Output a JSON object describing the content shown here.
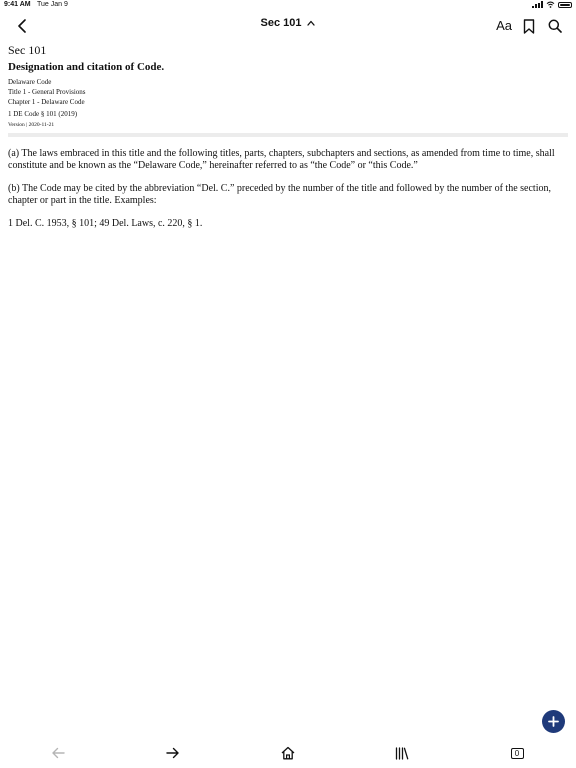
{
  "status_bar": {
    "time": "9:41 AM",
    "date": "Tue Jan 9"
  },
  "nav": {
    "title": "Sec 101",
    "font_size_button": "Aa",
    "icons": [
      "chevron-left-icon",
      "chevron-up-icon",
      "bookmark-icon",
      "search-icon"
    ]
  },
  "document": {
    "section_label": "Sec 101",
    "heading": "Designation and citation of Code.",
    "breadcrumb": [
      "Delaware Code",
      "Title 1 - General Provisions",
      "Chapter 1 - Delaware Code"
    ],
    "citation": "1 DE Code § 101 (2019)",
    "version": "Version | 2020-11-21",
    "paragraphs": [
      "(a) The laws embraced in this title and the following titles, parts, chapters, subchapters and sections, as amended from time to time, shall constitute and be known as the “Delaware Code,” hereinafter referred to as “the Code” or “this Code.”",
      "(b) The Code may be cited by the abbreviation “Del. C.” preceded by the number of the title and followed by the number of the section, chapter or part in the title. Examples:",
      "1 Del. C. 1953, § 101; 49 Del. Laws, c. 220, § 1."
    ]
  },
  "fab": {
    "icon": "plus-icon"
  },
  "tab_bar": {
    "icons": [
      "arrow-left-icon",
      "arrow-right-icon",
      "home-icon",
      "library-icon",
      "tabs-icon"
    ],
    "tabs_count": "0"
  },
  "colors": {
    "fab_background": "#1f3a7a",
    "disabled_icon": "#b5b5b5",
    "divider": "#ececec"
  }
}
